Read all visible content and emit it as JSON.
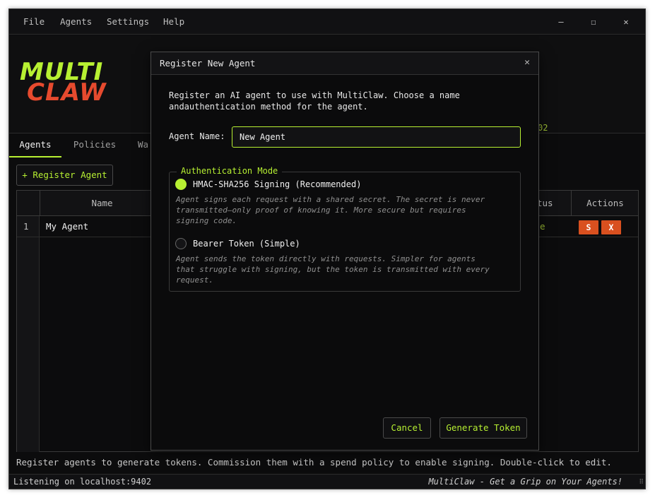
{
  "menubar": {
    "items": [
      "File",
      "Agents",
      "Settings",
      "Help"
    ],
    "minimize": "—",
    "maximize": "☐",
    "close": "✕"
  },
  "header": {
    "logo_line1": "MULTI",
    "logo_line2": "CLAW",
    "port_fragment": "02"
  },
  "tabs": [
    "Agents",
    "Policies",
    "Wa"
  ],
  "register_button": "+ Register Agent",
  "table": {
    "columns": [
      "Name",
      "tus",
      "Actions"
    ],
    "rows": [
      {
        "index": "1",
        "name": "My Agent",
        "status_fragment": "e",
        "action_s": "S",
        "action_x": "X"
      }
    ]
  },
  "hint": "Register agents to generate tokens. Commission them with a spend policy to enable signing. Double-click to edit.",
  "statusbar": {
    "left": "Listening on localhost:9402",
    "right": "MultiClaw - Get a Grip on Your Agents!"
  },
  "dialog": {
    "title": "Register New Agent",
    "close": "✕",
    "description_line1": "Register an AI agent to use with MultiClaw. Choose a name",
    "description_line2": "andauthentication method for the agent.",
    "name_label": "Agent Name:",
    "name_value": "New Agent",
    "auth_legend": "Authentication Mode",
    "options": [
      {
        "label": "HMAC-SHA256 Signing (Recommended)",
        "selected": true,
        "desc_lines": [
          "Agent signs each request with a shared secret. The secret is never",
          "transmitted—only proof of knowing it. More secure but requires",
          "signing code."
        ]
      },
      {
        "label": "Bearer Token (Simple)",
        "selected": false,
        "desc_lines": [
          "Agent sends the token directly with requests. Simpler for agents",
          "that struggle with signing, but the token is transmitted with every",
          "request."
        ]
      }
    ],
    "cancel": "Cancel",
    "generate": "Generate Token"
  },
  "colors": {
    "accent": "#b7f032",
    "brand_red": "#e64a2e",
    "action_button": "#d9501f",
    "background": "#0c0c0d"
  }
}
